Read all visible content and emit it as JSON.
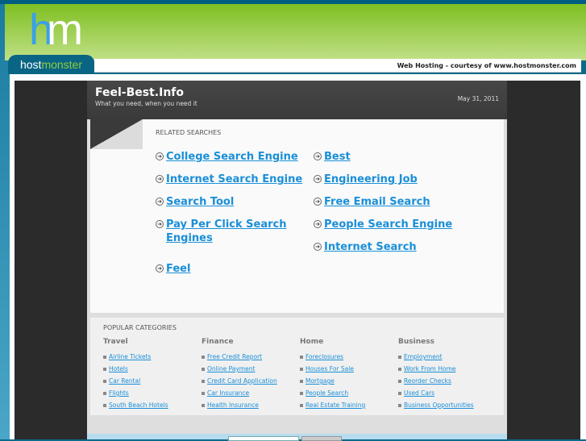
{
  "hosting_bar": {
    "logo_prefix": "host",
    "logo_suffix": "monster",
    "credit": "Web Hosting - courtesy of www.hostmonster.com"
  },
  "site": {
    "title": "Feel-Best.Info",
    "tagline": "What you need, when you need it",
    "date": "May 31, 2011"
  },
  "related": {
    "title": "RELATED SEARCHES",
    "left": [
      "College Search Engine",
      "Internet Search Engine",
      "Search Tool",
      "Pay Per Click Search Engines",
      "Feel"
    ],
    "right": [
      "Best",
      "Engineering Job",
      "Free Email Search",
      "People Search Engine",
      "Internet Search"
    ]
  },
  "popular": {
    "title": "POPULAR CATEGORIES",
    "columns": [
      {
        "heading": "Travel",
        "links": [
          "Airline Tickets",
          "Hotels",
          "Car Rental",
          "Flights",
          "South Beach Hotels"
        ]
      },
      {
        "heading": "Finance",
        "links": [
          "Free Credit Report",
          "Online Payment",
          "Credit Card Application",
          "Car Insurance",
          "Health Insurance"
        ]
      },
      {
        "heading": "Home",
        "links": [
          "Foreclosures",
          "Houses For Sale",
          "Mortgage",
          "People Search",
          "Real Estate Training"
        ]
      },
      {
        "heading": "Business",
        "links": [
          "Employment",
          "Work From Home",
          "Reorder Checks",
          "Used Cars",
          "Business Opportunities"
        ]
      }
    ]
  },
  "colors": {
    "link": "#1a8fd8",
    "header_green": "#7fbf22",
    "brand_teal": "#0a6585"
  }
}
